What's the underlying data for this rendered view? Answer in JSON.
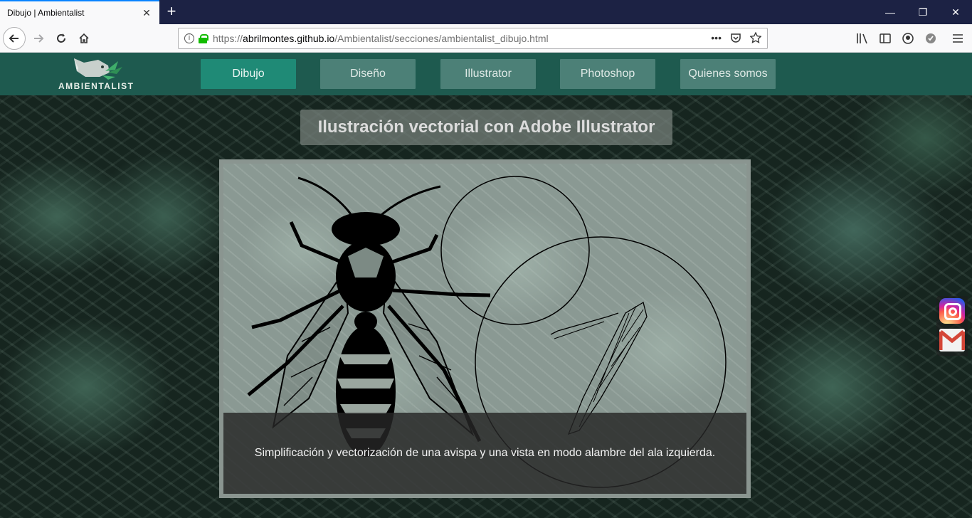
{
  "browser": {
    "tab_title": "Dibujo | Ambientalist",
    "tab_close": "✕",
    "new_tab": "+",
    "url_prefix": "https://",
    "url_host": "abrilmontes.github.io",
    "url_path": "/Ambientalist/secciones/ambientalist_dibujo.html",
    "url_menu": "•••",
    "window_min": "—",
    "window_max": "❐",
    "window_close": "✕"
  },
  "site": {
    "logo_text": "AMBIENTALIST",
    "menu": [
      {
        "label": "Dibujo",
        "active": true
      },
      {
        "label": "Diseño",
        "active": false
      },
      {
        "label": "Illustrator",
        "active": false
      },
      {
        "label": "Photoshop",
        "active": false
      },
      {
        "label": "Quienes somos",
        "active": false
      }
    ],
    "title": "Ilustración vectorial con Adobe Illustrator",
    "caption": "Simplificación y vectorización de una avispa y una vista en modo alambre del ala izquierda."
  },
  "social": {
    "icons": [
      "instagram-icon",
      "gmail-icon"
    ]
  },
  "colors": {
    "header": "#1e5a4f",
    "menu_active": "#1f8a76",
    "menu_inactive": "#4c8077",
    "browser_titlebar": "#1c2244"
  }
}
